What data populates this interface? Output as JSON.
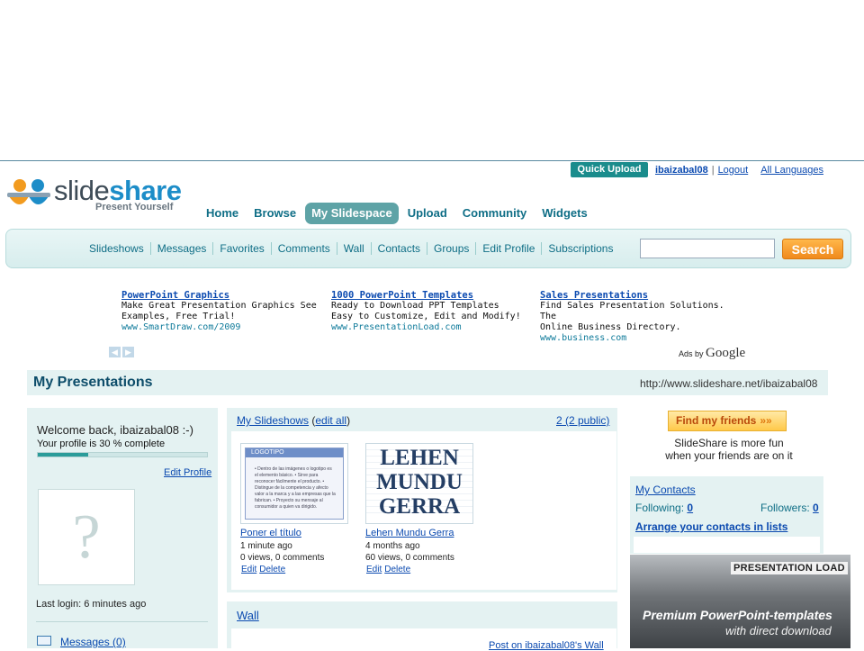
{
  "header": {
    "logo_name": "slideshare",
    "logo_part1": "slide",
    "logo_part2": "share",
    "tagline": "Present Yourself",
    "quick_upload": "Quick Upload",
    "username": "ibaizabal08",
    "logout": "Logout",
    "languages": "All Languages",
    "separator": "|"
  },
  "main_nav": [
    {
      "label": "Home",
      "active": false
    },
    {
      "label": "Browse",
      "active": false
    },
    {
      "label": "My Slidespace",
      "active": true
    },
    {
      "label": "Upload",
      "active": false
    },
    {
      "label": "Community",
      "active": false
    },
    {
      "label": "Widgets",
      "active": false
    }
  ],
  "sub_nav": [
    "Slideshows",
    "Messages",
    "Favorites",
    "Comments",
    "Wall",
    "Contacts",
    "Groups",
    "Edit Profile",
    "Subscriptions"
  ],
  "search": {
    "value": "",
    "button": "Search"
  },
  "ads": [
    {
      "title": "PowerPoint Graphics",
      "line1": "Make Great Presentation Graphics See",
      "line2": "Examples, Free Trial!",
      "url": "www.SmartDraw.com/2009"
    },
    {
      "title": "1000 PowerPoint Templates",
      "line1": "Ready to Download PPT Templates",
      "line2": "Easy to Customize, Edit and Modify!",
      "url": "www.PresentationLoad.com"
    },
    {
      "title": "Sales Presentations",
      "line1": "Find Sales Presentation Solutions. The",
      "line2": "Online Business Directory.",
      "url": "www.business.com"
    }
  ],
  "ads_by": {
    "prefix": "Ads by",
    "brand": "Google"
  },
  "presentations_header": {
    "title": "My Presentations",
    "url": "http://www.slideshare.net/ibaizabal08"
  },
  "profile": {
    "welcome": "Welcome back, ibaizabal08 :-)",
    "completeness": "Your profile is 30 % complete",
    "completeness_fraction": 0.3,
    "edit_profile": "Edit Profile",
    "avatar_placeholder": "?",
    "last_login_label": "Last login:",
    "last_login_value": "6 minutes ago",
    "messages": "Messages (0)"
  },
  "slideshows": {
    "title": "My Slideshows",
    "edit_all": "edit all",
    "edit_all_open": " (",
    "edit_all_close": ")",
    "count": "2 (2 public)",
    "items": [
      {
        "title": "Poner el título",
        "time": "1 minute ago",
        "stats": "0 views, 0 comments",
        "edit": "Edit",
        "delete": "Delete",
        "thumb_title": "LOGOTIPO",
        "thumb_lines": "• Dentro de las imágenes o logotipo es el elemento básico. • Sirve para reconocer fácilmente el producto. • Distingue de la competencia y afecto valor a la marca y a las empresas que la fabrican. • Proyecto su mensaje al consumidor a quien va dirigido."
      },
      {
        "title": "Lehen Mundu Gerra",
        "time": "4 months ago",
        "stats": "60 views, 0 comments",
        "edit": "Edit",
        "delete": "Delete",
        "thumb_title": "LEHEN MUNDU GERRA"
      }
    ]
  },
  "wall": {
    "title": "Wall",
    "post": "Post on ibaizabal08's Wall"
  },
  "friends": {
    "button": "Find my friends",
    "button_arrows": "»»",
    "line1": "SlideShare is more fun",
    "line2": "when your friends are on it"
  },
  "contacts": {
    "title": "My Contacts",
    "following_label": "Following:",
    "following_count": "0",
    "followers_label": "Followers:",
    "followers_count": "0",
    "arrange": "Arrange your contacts in lists"
  },
  "banner": {
    "logo": "PRESENTATION LOAD",
    "line1": "Premium PowerPoint-templates",
    "line2": "with direct download"
  },
  "colors": {
    "accent": "#5ea3a6",
    "link": "#0b4ab0",
    "nav_text": "#0f6e86",
    "search_button": "#f08a1c",
    "panel_bg": "#e4f2f2"
  }
}
